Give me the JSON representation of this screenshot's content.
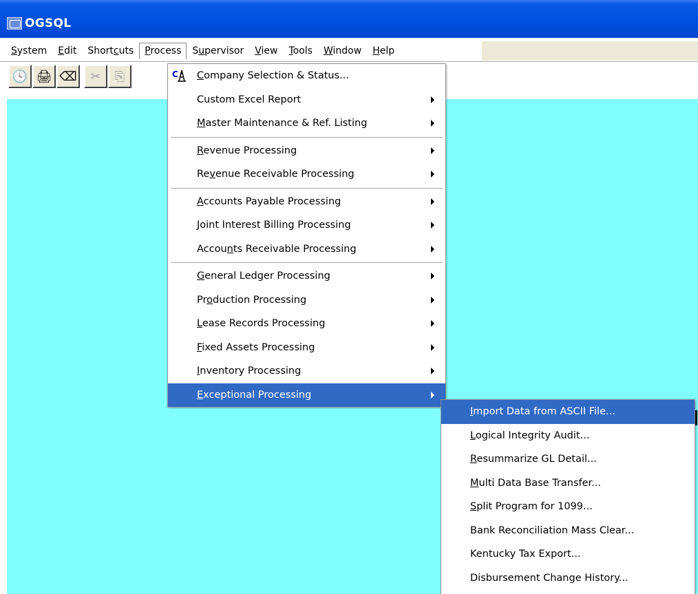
{
  "window": {
    "title": "OGSQL"
  },
  "menubar": [
    {
      "label": "System",
      "underline": "S"
    },
    {
      "label": "Edit",
      "underline": "E"
    },
    {
      "label": "Shortcuts",
      "underline": "c"
    },
    {
      "label": "Process",
      "underline": "P",
      "open": true
    },
    {
      "label": "Supervisor",
      "underline": "u"
    },
    {
      "label": "View",
      "underline": "V"
    },
    {
      "label": "Tools",
      "underline": "T"
    },
    {
      "label": "Window",
      "underline": "W"
    },
    {
      "label": "Help",
      "underline": "H"
    }
  ],
  "toolbar": {
    "buttons": [
      {
        "icon": "calendar-clock-icon",
        "glyph": "🕓",
        "enabled": true
      },
      {
        "icon": "print-preview-icon",
        "glyph": "🖨",
        "enabled": true
      },
      {
        "icon": "eraser-icon",
        "glyph": "⌫",
        "enabled": true
      },
      {
        "icon": "cut-icon",
        "glyph": "✂",
        "enabled": false
      },
      {
        "icon": "copy-icon",
        "glyph": "⎘",
        "enabled": false
      }
    ]
  },
  "process_menu": {
    "groups": [
      [
        {
          "label": "Company Selection & Status...",
          "underline": "C",
          "submenu": false,
          "icon": "company-oil-rig-icon"
        },
        {
          "label": "Custom Excel Report",
          "underline": "",
          "submenu": true
        },
        {
          "label": "Master Maintenance & Ref. Listing",
          "underline": "M",
          "submenu": true
        }
      ],
      [
        {
          "label": "Revenue Processing",
          "underline": "R",
          "submenu": true
        },
        {
          "label": "Revenue Receivable Processing",
          "underline": "v",
          "submenu": true
        }
      ],
      [
        {
          "label": "Accounts Payable Processing",
          "underline": "A",
          "submenu": true
        },
        {
          "label": "Joint Interest Billing Processing",
          "underline": "J",
          "submenu": true
        },
        {
          "label": "Accounts Receivable Processing",
          "underline": "n",
          "submenu": true
        }
      ],
      [
        {
          "label": "General Ledger Processing",
          "underline": "G",
          "submenu": true
        },
        {
          "label": "Production Processing",
          "underline": "o",
          "submenu": true
        },
        {
          "label": "Lease Records Processing",
          "underline": "L",
          "submenu": true
        },
        {
          "label": "Fixed Assets Processing",
          "underline": "F",
          "submenu": true
        },
        {
          "label": "Inventory Processing",
          "underline": "I",
          "submenu": true
        },
        {
          "label": "Exceptional Processing",
          "underline": "E",
          "submenu": true,
          "highlighted": true
        }
      ]
    ]
  },
  "exceptional_submenu": [
    {
      "label": "Import Data from ASCII File...",
      "underline": "I",
      "highlighted": true
    },
    {
      "label": "Logical Integrity Audit...",
      "underline": "L"
    },
    {
      "label": "Resummarize GL Detail...",
      "underline": "R"
    },
    {
      "label": "Multi Data Base Transfer...",
      "underline": "M"
    },
    {
      "label": "Split Program for 1099...",
      "underline": "S"
    },
    {
      "label": "Bank Reconciliation Mass Clear...",
      "underline": ""
    },
    {
      "label": "Kentucky Tax Export...",
      "underline": ""
    },
    {
      "label": "Disbursement Change History...",
      "underline": ""
    }
  ],
  "colors": {
    "titlebar": "#0050e0",
    "client": "#80ffff",
    "highlight": "#316ac5"
  }
}
